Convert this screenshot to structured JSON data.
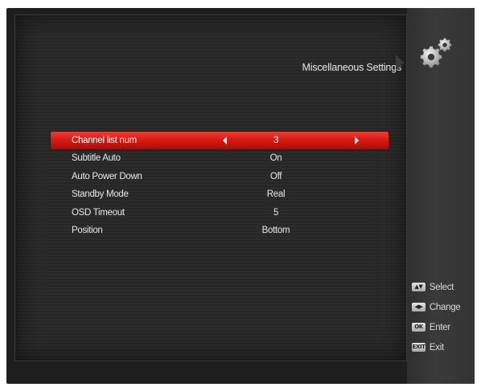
{
  "page": {
    "title": "Miscellaneous Settings"
  },
  "menu": {
    "items": [
      {
        "label": "Channel list num",
        "value": "3",
        "selected": true
      },
      {
        "label": "Subtitle Auto",
        "value": "On",
        "selected": false
      },
      {
        "label": "Auto Power Down",
        "value": "Off",
        "selected": false
      },
      {
        "label": "Standby Mode",
        "value": "Real",
        "selected": false
      },
      {
        "label": "OSD Timeout",
        "value": "5",
        "selected": false
      },
      {
        "label": "Position",
        "value": "Bottom",
        "selected": false
      }
    ]
  },
  "hints": [
    {
      "key": "▲▼",
      "label": "Select",
      "icon": "up-down-key-icon"
    },
    {
      "key": "◀▶",
      "label": "Change",
      "icon": "left-right-key-icon"
    },
    {
      "key": "OK",
      "label": "Enter",
      "icon": "ok-key-icon"
    },
    {
      "key": "EXIT",
      "label": "Exit",
      "icon": "exit-key-icon"
    }
  ],
  "colors": {
    "highlight": "#d81c14",
    "background": "#262626",
    "text": "#e8e8e8"
  },
  "icons": {
    "header": "gear-icon"
  }
}
